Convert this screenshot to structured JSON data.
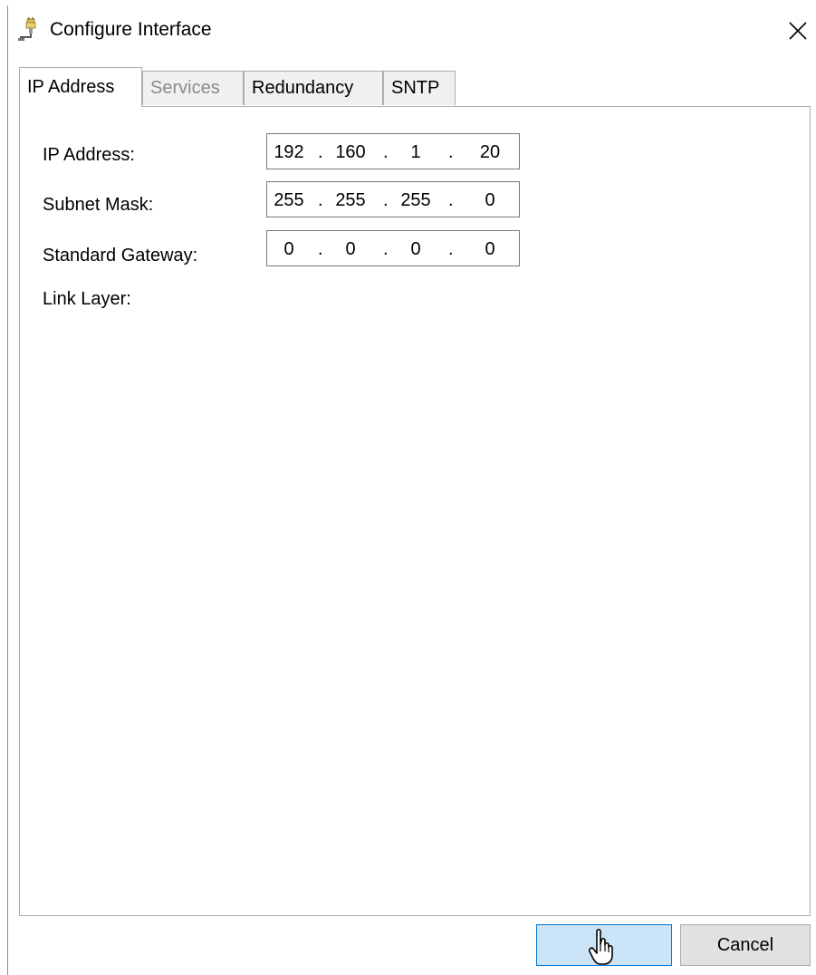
{
  "window": {
    "title": "Configure Interface",
    "icon": "network-plug-icon",
    "close_icon": "close-icon"
  },
  "tabs": [
    {
      "label": "IP Address",
      "state": "active"
    },
    {
      "label": "Services",
      "state": "disabled"
    },
    {
      "label": "Redundancy",
      "state": "normal"
    },
    {
      "label": "SNTP",
      "state": "normal"
    }
  ],
  "form": {
    "ip_address": {
      "label": "IP Address:",
      "octets": [
        "192",
        "160",
        "1",
        "20"
      ]
    },
    "subnet_mask": {
      "label": "Subnet Mask:",
      "octets": [
        "255",
        "255",
        "255",
        "0"
      ]
    },
    "standard_gateway": {
      "label": "Standard Gateway:",
      "octets": [
        "0",
        "0",
        "0",
        "0"
      ]
    },
    "link_layer": {
      "label": "Link Layer:"
    },
    "separator": "."
  },
  "buttons": {
    "ok_label": "",
    "cancel_label": "Cancel"
  },
  "colors": {
    "ok_button_bg": "#cce4f7",
    "ok_button_border": "#0078d7",
    "disabled_text": "#8a8a8a"
  }
}
